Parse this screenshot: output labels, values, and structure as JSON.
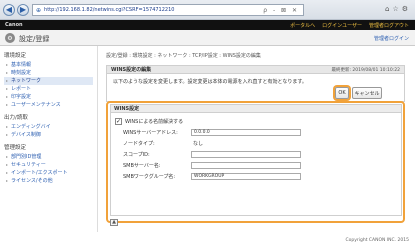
{
  "browser": {
    "url": "http://192.168.1.82/netwins.cgi?CSRF=1574712210",
    "search_hint": "ρ - ⊠ ✕"
  },
  "header": {
    "logo": "Canon",
    "links": [
      "ポータルへ",
      "ログインユーザー",
      "管理者ログアウト"
    ]
  },
  "titlebar": {
    "title": "設定/登録",
    "right_link": "管理者ログイン"
  },
  "sidebar": {
    "sections": [
      {
        "title": "環境設定",
        "items": [
          {
            "label": "基本情報",
            "active": false
          },
          {
            "label": "時刻設定",
            "active": false
          },
          {
            "label": "ネットワーク",
            "active": true
          },
          {
            "label": "レポート",
            "active": false
          },
          {
            "label": "印字設定",
            "active": false
          },
          {
            "label": "ユーザーメンテナンス",
            "active": false
          }
        ]
      },
      {
        "title": "出力/読取",
        "items": [
          {
            "label": "エンディングバイ",
            "active": false
          },
          {
            "label": "デバイス制御",
            "active": false
          }
        ]
      },
      {
        "title": "管理設定",
        "items": [
          {
            "label": "部門別ID管理",
            "active": false
          },
          {
            "label": "セキュリティー",
            "active": false
          },
          {
            "label": "インポート/エクスポート",
            "active": false
          },
          {
            "label": "ライセンス/その他",
            "active": false
          }
        ]
      }
    ]
  },
  "main": {
    "breadcrumb": "設定/登録 : 環境設定 : ネットワーク : TCP/IP設定 : WINS設定の編集",
    "panel": {
      "title": "WINS設定の編集",
      "date": "最終更新: 2019/08/01 10:10:22",
      "message": "以下のような設定を変更します。設定変更は本体の電源を入れ直すと有効となります。",
      "ok_label": "OK",
      "cancel_label": "キャンセル"
    },
    "wins": {
      "heading": "WINS設定",
      "checkbox_label": "WINSによる名前解決する",
      "checked": true,
      "fields": [
        {
          "label": "WINSサーバーアドレス:",
          "type": "input",
          "value": "0.0.0.0"
        },
        {
          "label": "ノードタイプ:",
          "type": "text",
          "value": "なし"
        },
        {
          "label": "スコープID:",
          "type": "input",
          "value": ""
        },
        {
          "label": "SMBサーバー名:",
          "type": "input",
          "value": ""
        },
        {
          "label": "SMBワークグループ名:",
          "type": "input",
          "value": "WORKGROUP"
        }
      ]
    }
  },
  "footer": {
    "copyright": "Copyright CANON INC. 2015"
  }
}
